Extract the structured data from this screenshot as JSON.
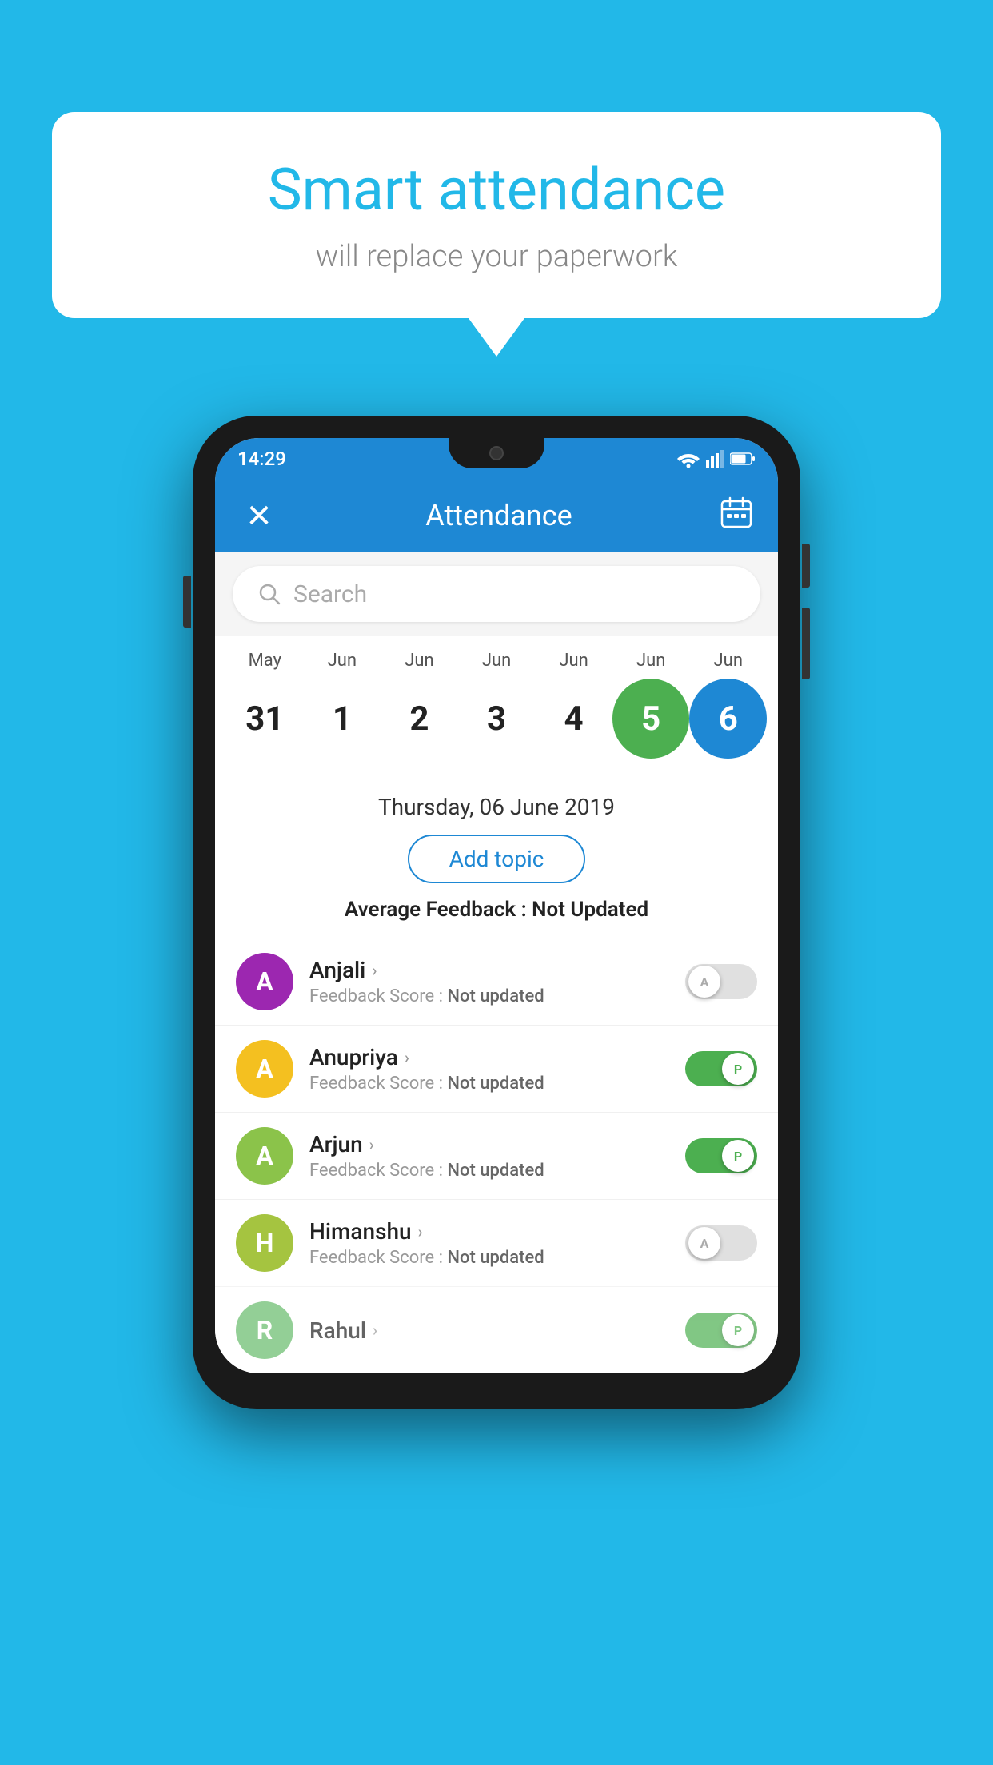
{
  "background_color": "#22b8e8",
  "speech_bubble": {
    "title": "Smart attendance",
    "subtitle": "will replace your paperwork"
  },
  "status_bar": {
    "time": "14:29",
    "wifi_icon": "wifi-icon",
    "signal_icon": "signal-icon",
    "battery_icon": "battery-icon"
  },
  "app_header": {
    "close_label": "✕",
    "title": "Attendance",
    "calendar_icon": "calendar-icon"
  },
  "search": {
    "placeholder": "Search"
  },
  "calendar": {
    "months": [
      "May",
      "Jun",
      "Jun",
      "Jun",
      "Jun",
      "Jun",
      "Jun"
    ],
    "dates": [
      "31",
      "1",
      "2",
      "3",
      "4",
      "5",
      "6"
    ],
    "today_index": 5,
    "selected_index": 6
  },
  "selected_date": {
    "text": "Thursday, 06 June 2019",
    "add_topic_label": "Add topic",
    "avg_feedback_label": "Average Feedback : ",
    "avg_feedback_value": "Not Updated"
  },
  "students": [
    {
      "name": "Anjali",
      "avatar_letter": "A",
      "avatar_color": "#9c27b0",
      "feedback_label": "Feedback Score : ",
      "feedback_value": "Not updated",
      "toggle_state": "off",
      "toggle_letter": "A"
    },
    {
      "name": "Anupriya",
      "avatar_letter": "A",
      "avatar_color": "#f4c020",
      "feedback_label": "Feedback Score : ",
      "feedback_value": "Not updated",
      "toggle_state": "on",
      "toggle_letter": "P"
    },
    {
      "name": "Arjun",
      "avatar_letter": "A",
      "avatar_color": "#8bc34a",
      "feedback_label": "Feedback Score : ",
      "feedback_value": "Not updated",
      "toggle_state": "on",
      "toggle_letter": "P"
    },
    {
      "name": "Himanshu",
      "avatar_letter": "H",
      "avatar_color": "#a5c440",
      "feedback_label": "Feedback Score : ",
      "feedback_value": "Not updated",
      "toggle_state": "off",
      "toggle_letter": "A"
    }
  ]
}
